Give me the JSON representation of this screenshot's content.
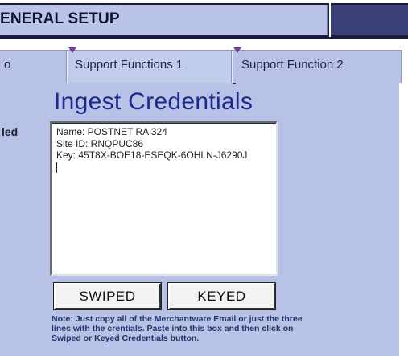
{
  "window": {
    "title": "ENERAL SETUP"
  },
  "tabs": [
    {
      "label": "o"
    },
    {
      "label": "Support Functions 1"
    },
    {
      "label": "Support Function 2"
    }
  ],
  "sidebar": {
    "partial_label": "led"
  },
  "main": {
    "heading": "Ingest Credentials",
    "credentials": {
      "lines": [
        "Name: POSTNET RA 324",
        "Site ID: RNQPUC86",
        "Key: 45T8X-BOE18-ESEQK-6OHLN-J6290J"
      ]
    },
    "buttons": {
      "swiped": "SWIPED",
      "keyed": "KEYED"
    },
    "note": "Note:  Just copy all of the Merchantware Email or just the three lines with the crentials.  Paste into this box and then click on Swiped or Keyed Credentials button."
  }
}
